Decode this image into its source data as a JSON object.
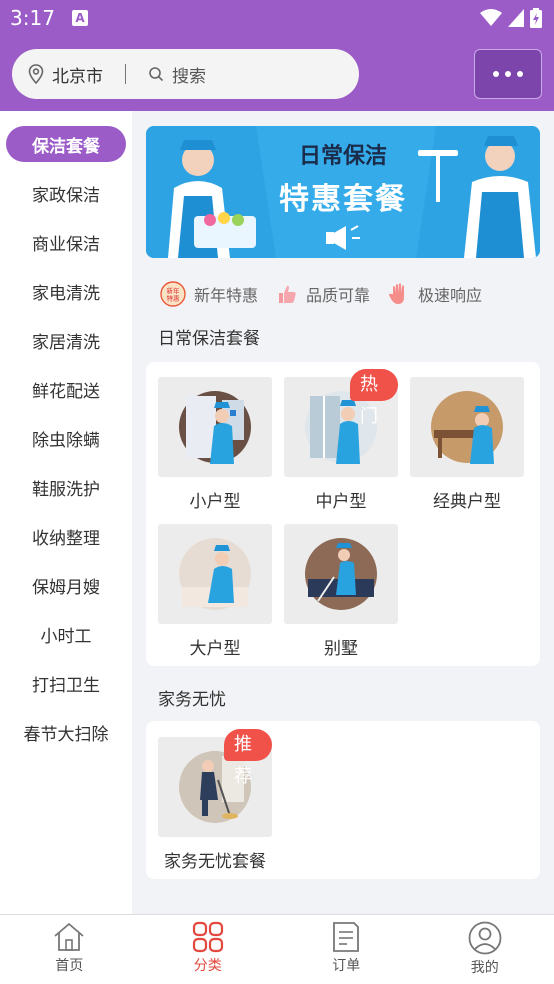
{
  "status": {
    "time": "3:17",
    "notif": "A"
  },
  "header": {
    "city": "北京市",
    "search_placeholder": "搜索"
  },
  "sidebar": {
    "items": [
      {
        "label": "保洁套餐",
        "active": true
      },
      {
        "label": "家政保洁"
      },
      {
        "label": "商业保洁"
      },
      {
        "label": "家电清洗"
      },
      {
        "label": "家居清洗"
      },
      {
        "label": "鲜花配送"
      },
      {
        "label": "除虫除螨"
      },
      {
        "label": "鞋服洗护"
      },
      {
        "label": "收纳整理"
      },
      {
        "label": "保姆月嫂"
      },
      {
        "label": "小时工"
      },
      {
        "label": "打扫卫生"
      },
      {
        "label": "春节大扫除"
      }
    ]
  },
  "banner": {
    "title": "日常保洁",
    "subtitle": "特惠套餐"
  },
  "features": [
    {
      "icon": "new-year-icon",
      "icon_text": "新年特惠",
      "label": "新年特惠"
    },
    {
      "icon": "thumbs-up-icon",
      "label": "品质可靠"
    },
    {
      "icon": "hand-icon",
      "label": "极速响应"
    }
  ],
  "sections": [
    {
      "title": "日常保洁套餐",
      "products": [
        {
          "name": "小户型"
        },
        {
          "name": "中户型",
          "badge": "热门"
        },
        {
          "name": "经典户型"
        },
        {
          "name": "大户型"
        },
        {
          "name": "别墅"
        }
      ]
    },
    {
      "title": "家务无忧",
      "products": [
        {
          "name": "家务无忧套餐",
          "badge": "推荐"
        }
      ]
    }
  ],
  "tabbar": {
    "items": [
      {
        "label": "首页",
        "icon": "home-icon"
      },
      {
        "label": "分类",
        "icon": "category-icon",
        "active": true
      },
      {
        "label": "订单",
        "icon": "order-icon"
      },
      {
        "label": "我的",
        "icon": "profile-icon"
      }
    ]
  },
  "colors": {
    "brand": "#9b5cc8",
    "accent": "#e2483d",
    "badge": "#f0524a"
  }
}
